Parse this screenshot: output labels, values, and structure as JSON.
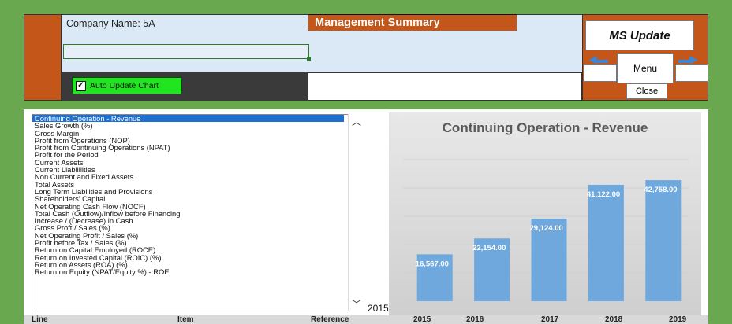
{
  "header": {
    "company_label": "Company Name: 5A",
    "title": "Management Summary",
    "auto_update_label": "Auto Update Chart",
    "auto_update_checked": true
  },
  "nav": {
    "ms_update": "MS Update",
    "menu": "Menu",
    "close": "Close",
    "arrow_left_icon": "arrow-left-icon",
    "arrow_right_icon": "arrow-right-icon"
  },
  "list": {
    "items": [
      "Continuing Operation - Revenue",
      "Sales Growth (%)",
      "Gross Margin",
      "Profit from Operations (NOP)",
      "Profit from Continuing Operations (NPAT)",
      "Profit for the Period",
      "Current Assets",
      "Current Liabililities",
      "Non Current and Fixed Assets",
      "Total Assets",
      "Long Term Liabilities  and Provisions",
      "Shareholders' Capital",
      "Net Operating Cash Flow (NOCF)",
      "Total Cash (Outflow)/Inflow before Financing",
      "Increase / (Decrease) in Cash",
      "Gross  Proft / Sales (%)",
      "Net Operating Profit / Sales (%)",
      "Profit before Tax / Sales (%)",
      "Return on Capital Employed (ROCE)",
      "Return on Invested Capital (ROIC) (%)",
      "Return on Assets (ROA) (%)",
      "Return on Equity (NPAT/Equity %) - ROE"
    ],
    "selected_index": 0
  },
  "year_label": "2015",
  "chart_data": {
    "type": "bar",
    "title": "Continuing Operation - Revenue",
    "categories": [
      "2015",
      "2016",
      "2017",
      "2018",
      "2019"
    ],
    "values": [
      16567,
      22154,
      29124,
      41122,
      42758
    ],
    "data_labels": [
      "16,567.00",
      "22,154.00",
      "29,124.00",
      "41,122.00",
      "42,758.00"
    ],
    "ylim": [
      0,
      50000
    ],
    "grid": true,
    "bar_color": "#6fa8dc"
  },
  "table_header": {
    "line": "Line",
    "item": "Item",
    "reference": "Reference",
    "years": [
      "2015",
      "2016",
      "2017",
      "2018",
      "2019"
    ]
  }
}
